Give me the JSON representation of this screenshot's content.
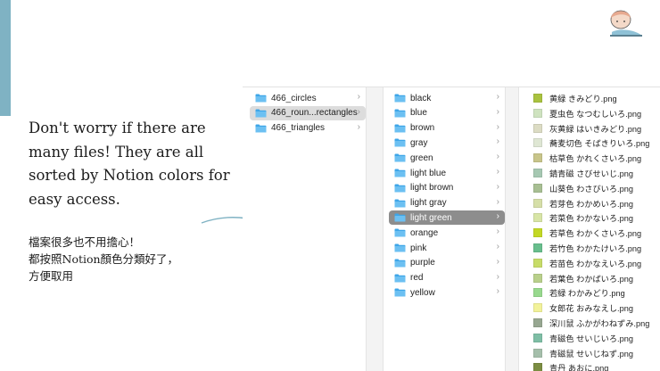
{
  "caption": {
    "english": "Don't worry if there are many files! They are all sorted by Notion colors for easy access.",
    "chinese": "檔案很多也不用擔心！\n都按照Notion顏色分類好了，\n方便取用"
  },
  "colors": {
    "accent_bar": "#7fb2c3",
    "folder_blue": "#3ea6e8",
    "selected_grey": "#dcdcdc",
    "selected_dark": "#8d8d8d"
  },
  "finder": {
    "column1": [
      {
        "name": "466_circles",
        "icon": "folder-icon",
        "selected": false
      },
      {
        "name": "466_roun...rectangles",
        "icon": "folder-icon",
        "selected": true
      },
      {
        "name": "466_triangles",
        "icon": "folder-icon",
        "selected": false
      }
    ],
    "column2": [
      {
        "name": "black",
        "icon": "folder-icon",
        "selected": false
      },
      {
        "name": "blue",
        "icon": "folder-icon",
        "selected": false
      },
      {
        "name": "brown",
        "icon": "folder-icon",
        "selected": false
      },
      {
        "name": "gray",
        "icon": "folder-icon",
        "selected": false
      },
      {
        "name": "green",
        "icon": "folder-icon",
        "selected": false
      },
      {
        "name": "light blue",
        "icon": "folder-icon",
        "selected": false
      },
      {
        "name": "light brown",
        "icon": "folder-icon",
        "selected": false
      },
      {
        "name": "light gray",
        "icon": "folder-icon",
        "selected": false
      },
      {
        "name": "light green",
        "icon": "folder-icon",
        "selected": true
      },
      {
        "name": "orange",
        "icon": "folder-icon",
        "selected": false
      },
      {
        "name": "pink",
        "icon": "folder-icon",
        "selected": false
      },
      {
        "name": "purple",
        "icon": "folder-icon",
        "selected": false
      },
      {
        "name": "red",
        "icon": "folder-icon",
        "selected": false
      },
      {
        "name": "yellow",
        "icon": "folder-icon",
        "selected": false
      }
    ],
    "column3": [
      {
        "name": "黄緑 きみどり.png",
        "swatch": "#a9c23f"
      },
      {
        "name": "夏虫色 なつむしいろ.png",
        "swatch": "#cfe3c0"
      },
      {
        "name": "灰黄緑 はいきみどり.png",
        "swatch": "#dcdcc4"
      },
      {
        "name": "蕎麦切色 そばきりいろ.png",
        "swatch": "#dfe7d4"
      },
      {
        "name": "枯草色 かれくさいろ.png",
        "swatch": "#c8c58a"
      },
      {
        "name": "錆青磁 さびせいじ.png",
        "swatch": "#a6c8b2"
      },
      {
        "name": "山葵色 わさびいろ.png",
        "swatch": "#a8bf93"
      },
      {
        "name": "若芽色 わかめいろ.png",
        "swatch": "#d6dfa8"
      },
      {
        "name": "若菜色 わかないろ.png",
        "swatch": "#d8e5a6"
      },
      {
        "name": "若草色 わかくさいろ.png",
        "swatch": "#c3d825"
      },
      {
        "name": "若竹色 わかたけいろ.png",
        "swatch": "#68be8d"
      },
      {
        "name": "若苗色 わかなえいろ.png",
        "swatch": "#c7dc68"
      },
      {
        "name": "若葉色 わかばいろ.png",
        "swatch": "#b9d08b"
      },
      {
        "name": "若緑 わかみどり.png",
        "swatch": "#98d98e"
      },
      {
        "name": "女郎花 おみなえし.png",
        "swatch": "#f2f29a"
      },
      {
        "name": "深川鼠 ふかがわねずみ.png",
        "swatch": "#97a791"
      },
      {
        "name": "青磁色 せいじいろ.png",
        "swatch": "#7ebea5"
      },
      {
        "name": "青磁鼠 せいじねず.png",
        "swatch": "#a5bfab"
      },
      {
        "name": "青丹 あおに.png",
        "swatch": "#7b8d42"
      }
    ],
    "chevron": "›"
  }
}
